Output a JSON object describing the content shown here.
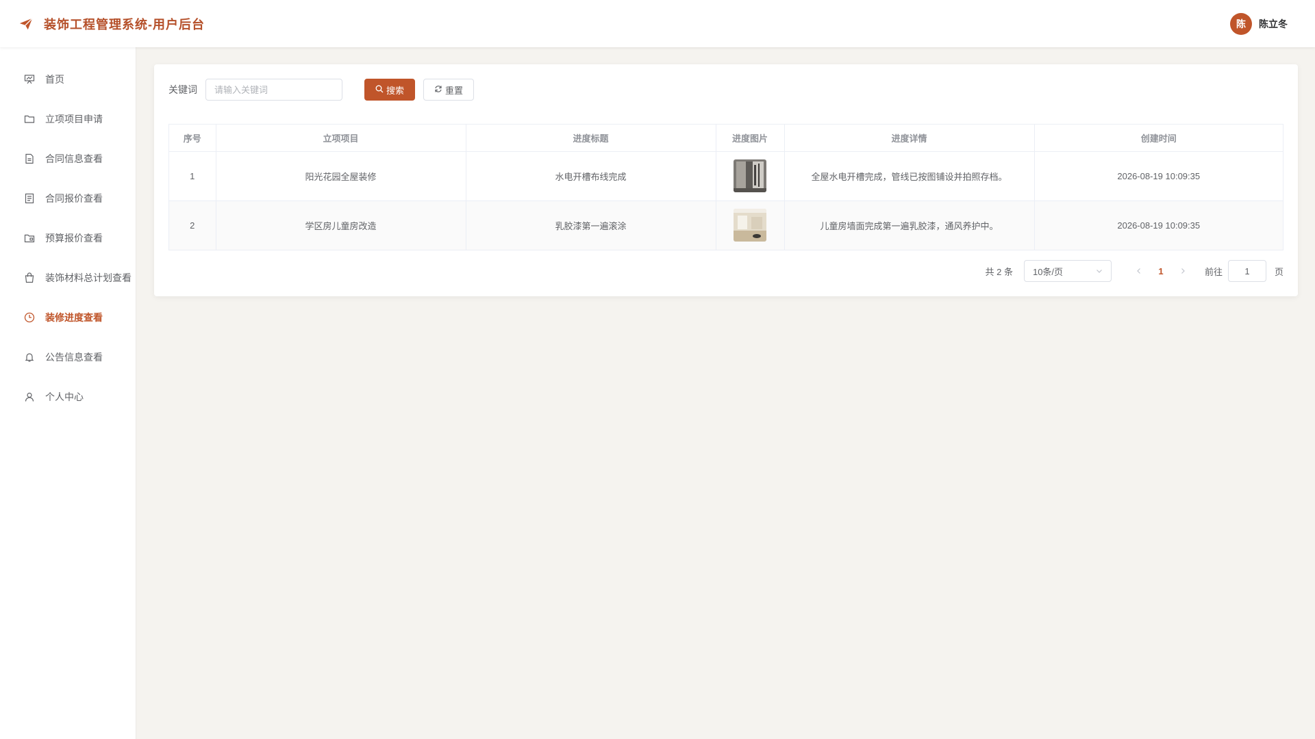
{
  "header": {
    "title": "装饰工程管理系统-用户后台",
    "logo_icon": "paper-plane-icon",
    "user": {
      "avatar_char": "陈",
      "name": "陈立冬"
    }
  },
  "sidebar": {
    "items": [
      {
        "label": "首页",
        "icon": "presentation-icon",
        "active": false
      },
      {
        "label": "立项项目申请",
        "icon": "folder-icon",
        "active": false
      },
      {
        "label": "合同信息查看",
        "icon": "document-icon",
        "active": false
      },
      {
        "label": "合同报价查看",
        "icon": "list-document-icon",
        "active": false
      },
      {
        "label": "预算报价查看",
        "icon": "folder-open-icon",
        "active": false
      },
      {
        "label": "装饰材料总计划查看",
        "icon": "shopping-bag-icon",
        "active": false
      },
      {
        "label": "装修进度查看",
        "icon": "clock-icon",
        "active": true
      },
      {
        "label": "公告信息查看",
        "icon": "bell-icon",
        "active": false
      },
      {
        "label": "个人中心",
        "icon": "user-icon",
        "active": false
      }
    ]
  },
  "search": {
    "label": "关键词",
    "placeholder": "请输入关键词",
    "search_button": "搜索",
    "reset_button": "重置"
  },
  "table": {
    "columns": [
      "序号",
      "立项项目",
      "进度标题",
      "进度图片",
      "进度详情",
      "创建时间"
    ],
    "rows": [
      {
        "index": "1",
        "project": "阳光花园全屋装修",
        "title": "水电开槽布线完成",
        "detail": "全屋水电开槽完成，管线已按图铺设并拍照存档。",
        "created": "2026-08-19 10:09:35"
      },
      {
        "index": "2",
        "project": "学区房儿童房改造",
        "title": "乳胶漆第一遍滚涂",
        "detail": "儿童房墙面完成第一遍乳胶漆，通风养护中。",
        "created": "2026-08-19 10:09:35"
      }
    ]
  },
  "pagination": {
    "total": "共 2 条",
    "page_size": "10条/页",
    "current_page": "1",
    "goto_label": "前往",
    "goto_value": "1",
    "goto_unit": "页"
  },
  "colors": {
    "accent": "#c0552a",
    "background": "#f5f3ef"
  }
}
